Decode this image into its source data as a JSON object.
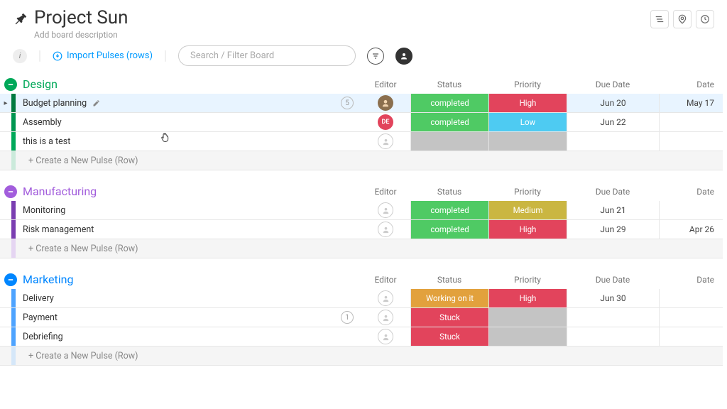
{
  "board": {
    "title": "Project Sun",
    "desc": "Add board description"
  },
  "toolbar": {
    "import_label": "Import Pulses (rows)",
    "search_placeholder": "Search / Filter Board"
  },
  "columns": {
    "editor": "Editor",
    "status": "Status",
    "priority": "Priority",
    "due": "Due Date",
    "date": "Date"
  },
  "groups": [
    {
      "id": "design",
      "title": "Design",
      "color": "green",
      "rows": [
        {
          "name": "Budget planning",
          "editing": true,
          "count": "5",
          "avatar": {
            "type": "photo",
            "bg": "#8b6f4e"
          },
          "status": {
            "label": "completed",
            "class": "status-completed"
          },
          "priority": {
            "label": "High",
            "class": "prio-high"
          },
          "due": "Jun 20",
          "date": "May 17"
        },
        {
          "name": "Assembly",
          "avatar": {
            "type": "initials",
            "text": "DE",
            "bg": "#e2445c"
          },
          "status": {
            "label": "completed",
            "class": "status-completed"
          },
          "priority": {
            "label": "Low",
            "class": "prio-low"
          },
          "due": "Jun 22",
          "date": ""
        },
        {
          "name": "this is a test",
          "avatar": {
            "type": "empty"
          },
          "status": {
            "label": "",
            "class": "status-empty"
          },
          "priority": {
            "label": "",
            "class": "prio-empty"
          },
          "due": "",
          "date": ""
        }
      ],
      "new_pulse": "+ Create a New Pulse (Row)"
    },
    {
      "id": "manufacturing",
      "title": "Manufacturing",
      "color": "purple",
      "rows": [
        {
          "name": "Monitoring",
          "avatar": {
            "type": "empty"
          },
          "status": {
            "label": "completed",
            "class": "status-completed"
          },
          "priority": {
            "label": "Medium",
            "class": "prio-med"
          },
          "due": "Jun 21",
          "date": ""
        },
        {
          "name": "Risk management",
          "avatar": {
            "type": "empty"
          },
          "status": {
            "label": "completed",
            "class": "status-completed"
          },
          "priority": {
            "label": "High",
            "class": "prio-high"
          },
          "due": "Jun 29",
          "date": "Apr 26"
        }
      ],
      "new_pulse": "+ Create a New Pulse (Row)"
    },
    {
      "id": "marketing",
      "title": "Marketing",
      "color": "blue",
      "rows": [
        {
          "name": "Delivery",
          "avatar": {
            "type": "empty"
          },
          "status": {
            "label": "Working on it",
            "class": "status-working"
          },
          "priority": {
            "label": "High",
            "class": "prio-high"
          },
          "due": "Jun 30",
          "date": ""
        },
        {
          "name": "Payment",
          "count": "1",
          "avatar": {
            "type": "empty"
          },
          "status": {
            "label": "Stuck",
            "class": "status-stuck"
          },
          "priority": {
            "label": "",
            "class": "prio-empty"
          },
          "due": "",
          "date": ""
        },
        {
          "name": "Debriefing",
          "avatar": {
            "type": "empty"
          },
          "status": {
            "label": "Stuck",
            "class": "status-stuck"
          },
          "priority": {
            "label": "",
            "class": "prio-empty"
          },
          "due": "",
          "date": ""
        }
      ],
      "new_pulse": "+ Create a New Pulse (Row)"
    }
  ]
}
